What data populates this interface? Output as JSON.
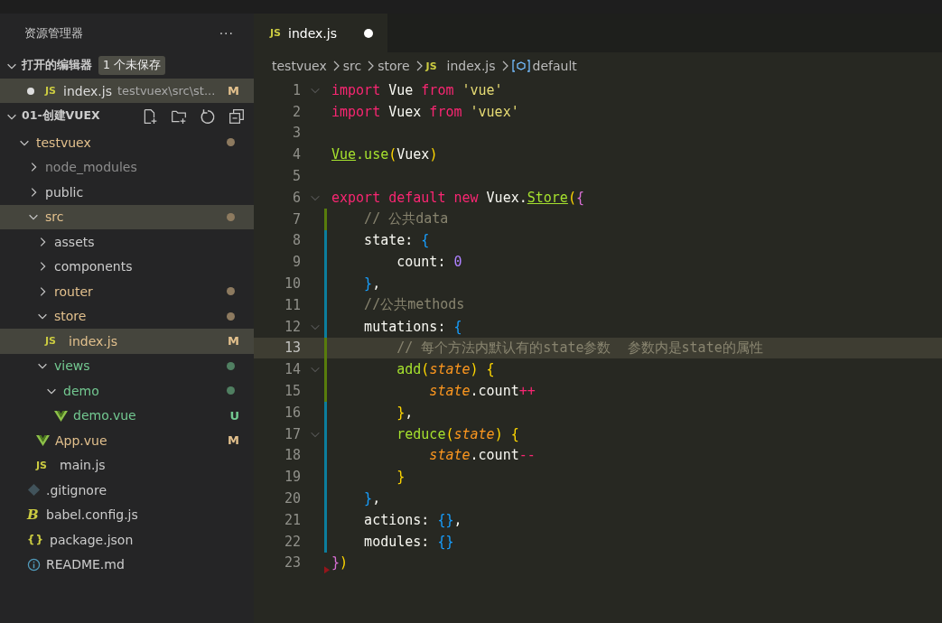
{
  "sidebar": {
    "title": "资源管理器",
    "more": "···",
    "open_editors": {
      "label": "打开的编辑器",
      "expanded": true,
      "badge": "1 个未保存",
      "items": [
        {
          "kind": "js",
          "icon_text": "JS",
          "name": "index.js",
          "path": "testvuex\\src\\st...",
          "status": "M",
          "dirty": true,
          "selected": true
        }
      ]
    },
    "project": {
      "label": "01-创建VUEX",
      "expanded": true,
      "tree": [
        {
          "name": "testvuex",
          "kind": "folder",
          "color": "#e2c08d",
          "expanded": true,
          "selected": false,
          "dot": true,
          "children": [
            {
              "name": "node_modules",
              "kind": "folder",
              "color": "#8c8c8c",
              "expanded": false,
              "selected": false,
              "dot": false
            },
            {
              "name": "public",
              "kind": "folder",
              "color": "#cccccc",
              "expanded": false,
              "selected": false,
              "dot": false
            },
            {
              "name": "src",
              "kind": "folder",
              "color": "#e2c08d",
              "expanded": true,
              "selected": true,
              "dot": true,
              "children": [
                {
                  "name": "assets",
                  "kind": "folder",
                  "color": "#cccccc",
                  "expanded": false,
                  "selected": false,
                  "dot": false
                },
                {
                  "name": "components",
                  "kind": "folder",
                  "color": "#cccccc",
                  "expanded": false,
                  "selected": false,
                  "dot": false
                },
                {
                  "name": "router",
                  "kind": "folder",
                  "color": "#e2c08d",
                  "expanded": false,
                  "selected": false,
                  "dot": true
                },
                {
                  "name": "store",
                  "kind": "folder",
                  "color": "#e2c08d",
                  "expanded": true,
                  "selected": false,
                  "dot": true,
                  "children": [
                    {
                      "name": "index.js",
                      "kind": "js",
                      "icon_text": "JS",
                      "color": "#e2c08d",
                      "status": "M",
                      "selected": true,
                      "dot": false
                    }
                  ]
                },
                {
                  "name": "views",
                  "kind": "folder",
                  "color": "#73c991",
                  "expanded": true,
                  "selected": false,
                  "dot": true,
                  "children": [
                    {
                      "name": "demo",
                      "kind": "folder",
                      "color": "#73c991",
                      "expanded": true,
                      "selected": false,
                      "dot": true,
                      "children": [
                        {
                          "name": "demo.vue",
                          "kind": "vue",
                          "color": "#73c991",
                          "status": "U",
                          "selected": false,
                          "dot": false
                        }
                      ]
                    }
                  ]
                },
                {
                  "name": "App.vue",
                  "kind": "vue",
                  "color": "#e2c08d",
                  "status": "M",
                  "selected": false,
                  "dot": false
                },
                {
                  "name": "main.js",
                  "kind": "js",
                  "icon_text": "JS",
                  "color": "#cccccc",
                  "selected": false,
                  "dot": false
                }
              ]
            },
            {
              "name": ".gitignore",
              "kind": "git",
              "color": "#cccccc",
              "selected": false,
              "dot": false
            },
            {
              "name": "babel.config.js",
              "kind": "babel",
              "icon_text": "B",
              "color": "#cccccc",
              "selected": false,
              "dot": false
            },
            {
              "name": "package.json",
              "kind": "json",
              "icon_text": "{}",
              "color": "#cccccc",
              "selected": false,
              "dot": false
            },
            {
              "name": "README.md",
              "kind": "info",
              "color": "#cccccc",
              "selected": false,
              "dot": false
            }
          ]
        }
      ]
    }
  },
  "tabs": [
    {
      "icon_text": "JS",
      "label": "index.js",
      "dirty": true,
      "selected": true
    }
  ],
  "breadcrumb": [
    {
      "label": "testvuex",
      "kind": "folder"
    },
    {
      "label": "src",
      "kind": "folder"
    },
    {
      "label": "store",
      "kind": "folder"
    },
    {
      "label": "index.js",
      "kind": "js",
      "icon_text": "JS"
    },
    {
      "label": "default",
      "kind": "symbol"
    }
  ],
  "code": [
    {
      "n": "1",
      "fold": true,
      "current": false,
      "kind": "unchanged",
      "tokens": [
        {
          "kind": "kw",
          "text": "import"
        },
        {
          "kind": "v",
          "text": " Vue"
        },
        {
          "kind": "kw",
          "text": " from"
        },
        {
          "kind": "str",
          "text": " 'vue'"
        }
      ]
    },
    {
      "n": "2",
      "fold": false,
      "current": false,
      "kind": "unchanged",
      "tokens": [
        {
          "kind": "kw",
          "text": "import"
        },
        {
          "kind": "v",
          "text": " Vuex"
        },
        {
          "kind": "kw",
          "text": " from"
        },
        {
          "kind": "str",
          "text": " 'vuex'"
        }
      ]
    },
    {
      "n": "3",
      "fold": false,
      "current": false,
      "kind": "unchanged"
    },
    {
      "n": "4",
      "fold": false,
      "current": false,
      "kind": "unchanged",
      "tokens": [
        {
          "kind": "fnu",
          "text": "Vue"
        },
        {
          "kind": "fn",
          "text": ".use"
        },
        {
          "kind": "b1",
          "text": "("
        },
        {
          "kind": "v",
          "text": "Vuex"
        },
        {
          "kind": "b1",
          "text": ")"
        }
      ]
    },
    {
      "n": "5",
      "fold": false,
      "current": false,
      "kind": "unchanged"
    },
    {
      "n": "6",
      "fold": true,
      "current": false,
      "kind": "unchanged",
      "tokens": [
        {
          "kind": "kw",
          "text": "export default new"
        },
        {
          "kind": "v",
          "text": " Vuex."
        },
        {
          "kind": "fnu",
          "text": "Store"
        },
        {
          "kind": "b1",
          "text": "("
        },
        {
          "kind": "b2",
          "text": "{"
        }
      ]
    },
    {
      "n": "7",
      "fold": false,
      "current": false,
      "kind": "added",
      "tokens": [
        {
          "kind": "cmt",
          "text": "    // 公共data"
        }
      ]
    },
    {
      "n": "8",
      "fold": false,
      "current": false,
      "kind": "modified",
      "tokens": [
        {
          "kind": "v",
          "text": "    state:"
        },
        {
          "kind": "b3",
          "text": " {"
        }
      ]
    },
    {
      "n": "9",
      "fold": false,
      "current": false,
      "kind": "modified",
      "tokens": [
        {
          "kind": "v",
          "text": "        count:"
        },
        {
          "kind": "num",
          "text": " 0"
        }
      ]
    },
    {
      "n": "10",
      "fold": false,
      "current": false,
      "kind": "modified",
      "tokens": [
        {
          "kind": "b3",
          "text": "    }"
        },
        {
          "kind": "v",
          "text": ","
        }
      ]
    },
    {
      "n": "11",
      "fold": false,
      "current": false,
      "kind": "modified",
      "tokens": [
        {
          "kind": "cmt",
          "text": "    //公共methods"
        }
      ]
    },
    {
      "n": "12",
      "fold": true,
      "current": false,
      "kind": "modified",
      "tokens": [
        {
          "kind": "v",
          "text": "    mutations:"
        },
        {
          "kind": "b3",
          "text": " {"
        }
      ]
    },
    {
      "n": "13",
      "fold": false,
      "current": true,
      "kind": "added",
      "tokens": [
        {
          "kind": "cmt",
          "text": "        // 每个方法内默认有的state参数  参数内是state的属性"
        }
      ]
    },
    {
      "n": "14",
      "fold": true,
      "current": false,
      "kind": "added",
      "tokens": [
        {
          "kind": "fn",
          "text": "        add"
        },
        {
          "kind": "b1",
          "text": "("
        },
        {
          "kind": "param",
          "text": "state"
        },
        {
          "kind": "b1",
          "text": ")"
        },
        {
          "kind": "b1",
          "text": " {"
        }
      ]
    },
    {
      "n": "15",
      "fold": false,
      "current": false,
      "kind": "added",
      "tokens": [
        {
          "kind": "param",
          "text": "            state"
        },
        {
          "kind": "v",
          "text": ".count"
        },
        {
          "kind": "kw",
          "text": "++"
        }
      ]
    },
    {
      "n": "16",
      "fold": false,
      "current": false,
      "kind": "modified",
      "tokens": [
        {
          "kind": "b1",
          "text": "        }"
        },
        {
          "kind": "v",
          "text": ","
        }
      ]
    },
    {
      "n": "17",
      "fold": true,
      "current": false,
      "kind": "modified",
      "tokens": [
        {
          "kind": "fn",
          "text": "        reduce"
        },
        {
          "kind": "b1",
          "text": "("
        },
        {
          "kind": "param",
          "text": "state"
        },
        {
          "kind": "b1",
          "text": ")"
        },
        {
          "kind": "b1",
          "text": " {"
        }
      ]
    },
    {
      "n": "18",
      "fold": false,
      "current": false,
      "kind": "modified",
      "tokens": [
        {
          "kind": "param",
          "text": "            state"
        },
        {
          "kind": "v",
          "text": ".count"
        },
        {
          "kind": "kw",
          "text": "--"
        }
      ]
    },
    {
      "n": "19",
      "fold": false,
      "current": false,
      "kind": "modified",
      "tokens": [
        {
          "kind": "b1",
          "text": "        }"
        }
      ]
    },
    {
      "n": "20",
      "fold": false,
      "current": false,
      "kind": "modified",
      "tokens": [
        {
          "kind": "b3",
          "text": "    }"
        },
        {
          "kind": "v",
          "text": ","
        }
      ]
    },
    {
      "n": "21",
      "fold": false,
      "current": false,
      "kind": "modified",
      "tokens": [
        {
          "kind": "v",
          "text": "    actions:"
        },
        {
          "kind": "b3",
          "text": " {}"
        },
        {
          "kind": "v",
          "text": ","
        }
      ]
    },
    {
      "n": "22",
      "fold": false,
      "current": false,
      "kind": "modified",
      "tokens": [
        {
          "kind": "v",
          "text": "    modules:"
        },
        {
          "kind": "b3",
          "text": " {}"
        }
      ]
    },
    {
      "n": "23",
      "fold": false,
      "current": false,
      "kind": "deleted",
      "tokens": [
        {
          "kind": "b2",
          "text": "}"
        },
        {
          "kind": "b1",
          "text": ")"
        }
      ]
    }
  ]
}
